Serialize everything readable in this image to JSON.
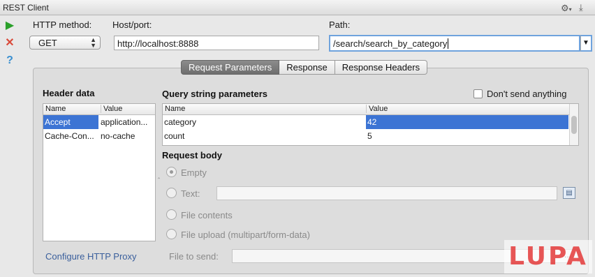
{
  "window": {
    "title": "REST Client"
  },
  "toolbar": {
    "run_icon": "run-icon",
    "stop_icon": "stop-icon",
    "help_icon": "help-icon",
    "settings_icon": "gear-icon",
    "hide_icon": "download-icon"
  },
  "request": {
    "method_label": "HTTP method:",
    "method_value": "GET",
    "host_label": "Host/port:",
    "host_value": "http://localhost:8888",
    "path_label": "Path:",
    "path_value": "/search/search_by_category"
  },
  "tabs": [
    {
      "label": "Request Parameters",
      "active": true
    },
    {
      "label": "Response",
      "active": false
    },
    {
      "label": "Response Headers",
      "active": false
    }
  ],
  "header_data": {
    "title": "Header data",
    "columns": [
      "Name",
      "Value"
    ],
    "rows": [
      {
        "name": "Accept",
        "value": "application...",
        "selected": true
      },
      {
        "name": "Cache-Con...",
        "value": "no-cache",
        "selected": false
      }
    ]
  },
  "query": {
    "title": "Query string parameters",
    "dont_send_label": "Don't send anything",
    "dont_send_checked": false,
    "columns": [
      "Name",
      "Value"
    ],
    "rows": [
      {
        "name": "category",
        "value": "42",
        "selected_value": true
      },
      {
        "name": "count",
        "value": "5",
        "selected_value": false
      }
    ]
  },
  "request_body": {
    "title": "Request body",
    "options": [
      {
        "label": "Empty",
        "selected": true
      },
      {
        "label": "Text:",
        "selected": false
      },
      {
        "label": "File contents",
        "selected": false
      },
      {
        "label": "File upload (multipart/form-data)",
        "selected": false
      }
    ],
    "text_value": "",
    "file_to_send_label": "File to send:",
    "file_to_send_value": "",
    "browse_label": "..."
  },
  "footer": {
    "proxy_link": "Configure HTTP Proxy"
  },
  "watermark": "LUPA",
  "colors": {
    "selection": "#3c74d4",
    "link": "#3a5f9c",
    "run": "#2aa02a",
    "stop": "#d94a3a",
    "help": "#3a8fd0"
  }
}
